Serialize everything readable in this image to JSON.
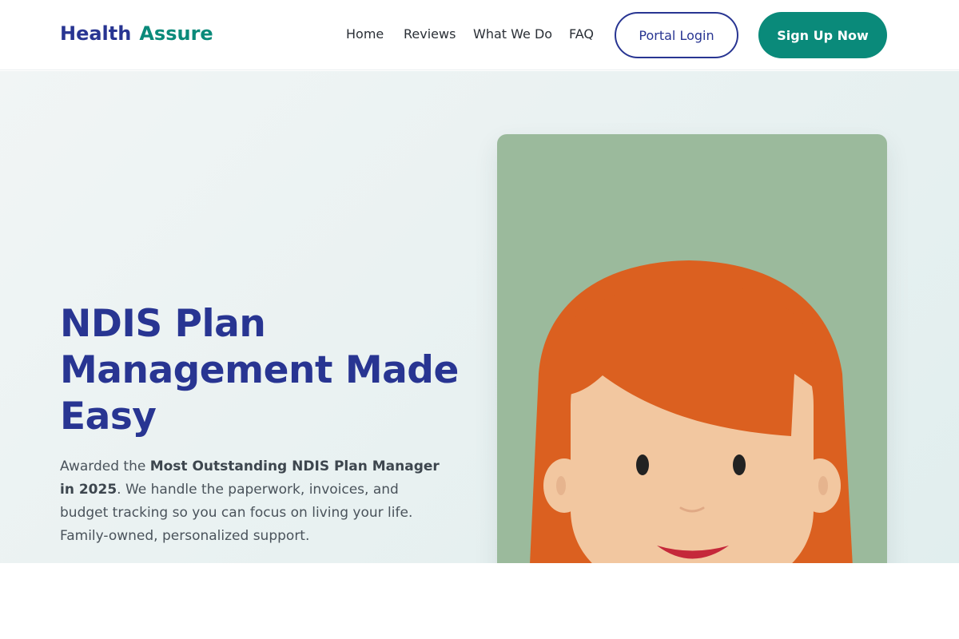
{
  "header": {
    "logo": {
      "word1": "Health",
      "word2": "Assure"
    },
    "nav": [
      {
        "label": "Home"
      },
      {
        "label": "Reviews"
      },
      {
        "label": "What We Do"
      },
      {
        "label": "FAQ"
      }
    ],
    "login_label": "Portal Login",
    "signup_label": "Sign Up Now"
  },
  "hero": {
    "title": "NDIS Plan Management Made Easy",
    "description": {
      "before": "Awarded the ",
      "bold": "Most Outstanding NDIS Plan Manager in 2025",
      "after": ". We handle the paperwork, invoices, and budget tracking so you can focus on living your life. Family-owned, personalized support."
    },
    "illustration_icon": "woman-avatar-illustration"
  },
  "colors": {
    "brand_navy": "#283592",
    "brand_teal": "#0a8a7a",
    "illustration_bg": "#9bba9c",
    "hair": "#db6020",
    "skin": "#f2c7a0"
  }
}
